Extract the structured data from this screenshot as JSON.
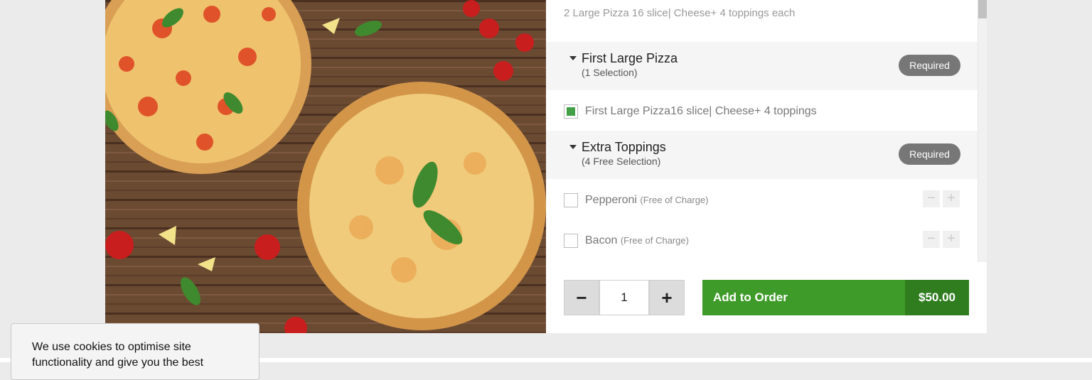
{
  "item": {
    "description": "2 Large Pizza 16 slice| Cheese+ 4 toppings each"
  },
  "groups": [
    {
      "title": "First Large Pizza",
      "subtitle": "(1 Selection)",
      "badge": "Required",
      "options": [
        {
          "label": "First Large Pizza16 slice| Cheese+ 4 toppings",
          "checked": true
        }
      ]
    },
    {
      "title": "Extra Toppings",
      "subtitle": "(4 Free Selection)",
      "badge": "Required",
      "options": [
        {
          "label": "Pepperoni",
          "note": "(Free of Charge)",
          "checked": false
        },
        {
          "label": "Bacon",
          "note": "(Free of Charge)",
          "checked": false
        }
      ]
    }
  ],
  "order": {
    "quantity": "1",
    "add_label": "Add to Order",
    "price": "$50.00"
  },
  "cookie": {
    "text": "We use cookies to optimise site functionality and give you the best"
  },
  "icons": {
    "caret": "caret-down-icon",
    "minus": "minus-icon",
    "plus": "plus-icon",
    "checkbox": "checkbox-icon"
  },
  "colors": {
    "accent_green": "#3f9b29",
    "price_green": "#2f7d1f",
    "badge_gray": "#777777",
    "checked_green": "#43a047"
  }
}
